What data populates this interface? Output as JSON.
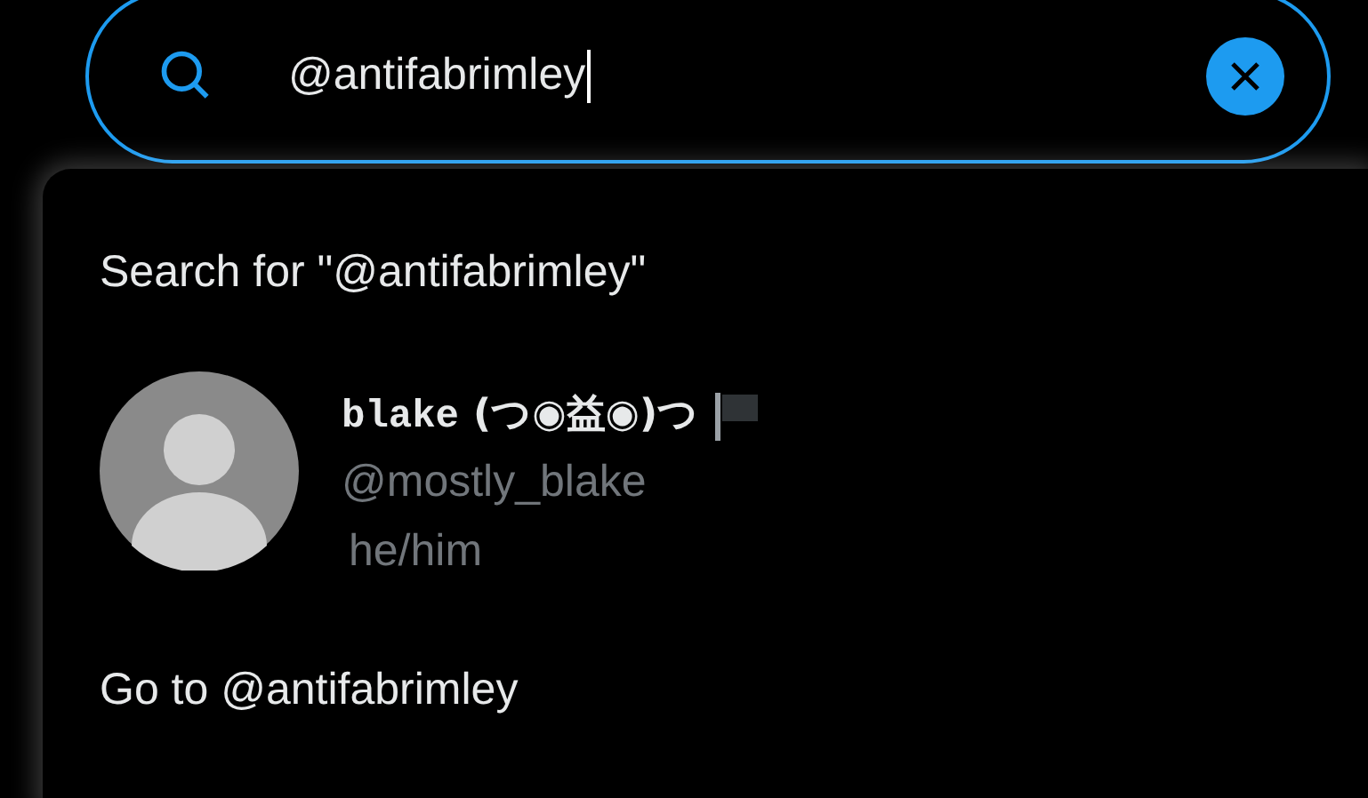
{
  "search": {
    "value": "@antifabrimley"
  },
  "dropdown": {
    "search_for": "Search for \"@antifabrimley\"",
    "users": [
      {
        "name_mono": "blake",
        "name_rest": "(つ◉益◉)つ",
        "handle": "@mostly_blake",
        "bio": "he/him"
      }
    ],
    "go_to": "Go to @antifabrimley"
  }
}
